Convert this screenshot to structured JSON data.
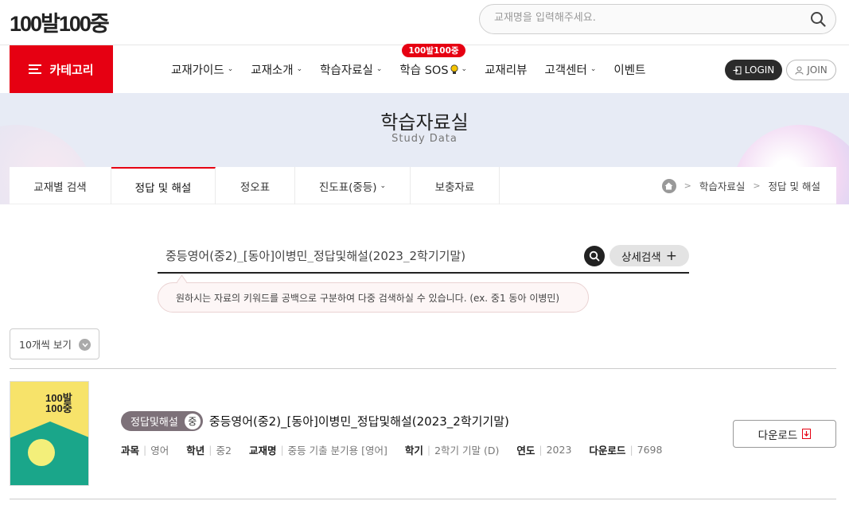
{
  "header": {
    "logo_text": "100발100중",
    "search_placeholder": "교재명을 입력해주세요."
  },
  "nav": {
    "category_label": "카테고리",
    "items": [
      {
        "label": "교재가이드",
        "dropdown": true
      },
      {
        "label": "교재소개",
        "dropdown": true
      },
      {
        "label": "학습자료실",
        "dropdown": true
      },
      {
        "label": "학습 SOS",
        "dropdown": true,
        "badge": "100발100중"
      },
      {
        "label": "교재리뷰",
        "dropdown": false
      },
      {
        "label": "고객센터",
        "dropdown": true
      },
      {
        "label": "이벤트",
        "dropdown": false
      }
    ],
    "login_label": "LOGIN",
    "join_label": "JOIN"
  },
  "hero": {
    "title": "학습자료실",
    "subtitle": "Study Data"
  },
  "subnav": {
    "tabs": [
      {
        "label": "교재별 검색",
        "active": false
      },
      {
        "label": "정답 및 해설",
        "active": true
      },
      {
        "label": "정오표",
        "active": false
      },
      {
        "label": "진도표(중등)",
        "active": false
      },
      {
        "label": "보충자료",
        "active": false
      }
    ],
    "breadcrumb": [
      "학습자료실",
      "정답 및 해설"
    ]
  },
  "search": {
    "value": "중등영어(중2)_[동아]이병민_정답및해설(2023_2학기기말)",
    "advanced_label": "상세검색",
    "hint": "원하시는 자료의 키워드를 공백으로 구분하여 다중 검색하실 수 있습니다. (ex. 중1 동아 이병민)"
  },
  "list": {
    "per_page_label": "10개씩 보기",
    "results": [
      {
        "type_badge": "정답및해설",
        "level": "중",
        "title": "중등영어(중2)_[동아]이병민_정답및해설(2023_2학기기말)",
        "cover_title": "100발 100중",
        "meta": [
          {
            "key": "과목",
            "value": "영어"
          },
          {
            "key": "학년",
            "value": "중2"
          },
          {
            "key": "교재명",
            "value": "중등 기출 분기용 [영어]"
          },
          {
            "key": "학기",
            "value": "2학기 기말 (D)"
          },
          {
            "key": "연도",
            "value": "2023"
          },
          {
            "key": "다운로드",
            "value": "7698"
          }
        ],
        "download_label": "다운로드"
      }
    ]
  },
  "colors": {
    "brand_red": "#e60012",
    "dark": "#222222",
    "badge_gray": "#7d7179"
  }
}
